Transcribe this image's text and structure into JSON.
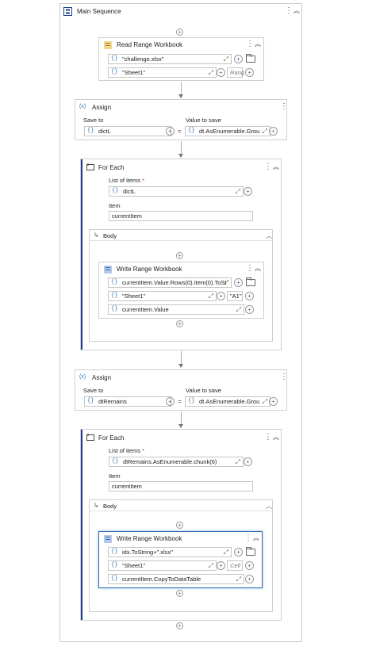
{
  "main_sequence": {
    "title": "Main Sequence"
  },
  "read_range": {
    "title": "Read Range Workbook",
    "path": "\"challenge.xlsx\"",
    "sheet": "\"Sheet1\"",
    "range_placeholder": "Rang"
  },
  "assign1": {
    "title": "Assign",
    "save_to_label": "Save to",
    "value_label": "Value to save",
    "save_to": "dictL",
    "value": "dt.AsEnumerable.Grou"
  },
  "foreach1": {
    "title": "For Each",
    "list_label": "List of items",
    "list_value": "dictL",
    "item_label": "Item",
    "item_value": "currentItem",
    "body_title": "Body"
  },
  "write1": {
    "title": "Write Range Workbook",
    "path": "currentItem.Value.Rows(0).Item(0).ToSt",
    "sheet": "\"Sheet1\"",
    "cell": "\"A1\"",
    "data": "currentItem.Value"
  },
  "assign2": {
    "title": "Assign",
    "save_to_label": "Save to",
    "value_label": "Value to save",
    "save_to": "dtRemains",
    "value": "dt.AsEnumerable.Grou"
  },
  "foreach2": {
    "title": "For Each",
    "list_label": "List of items",
    "list_value": "dtRemains.AsEnumerable.chunk(6)",
    "item_label": "Item",
    "item_value": "currentItem",
    "body_title": "Body"
  },
  "write2": {
    "title": "Write Range Workbook",
    "path": "idx.ToString+\".xlsx\"",
    "sheet": "\"Sheet1\"",
    "cell_placeholder": "Cell",
    "data": "currentItem.CopyToDataTable"
  },
  "symbols": {
    "star": "*",
    "equals": "=",
    "brace": "{}",
    "assign_badge": "(x)"
  }
}
